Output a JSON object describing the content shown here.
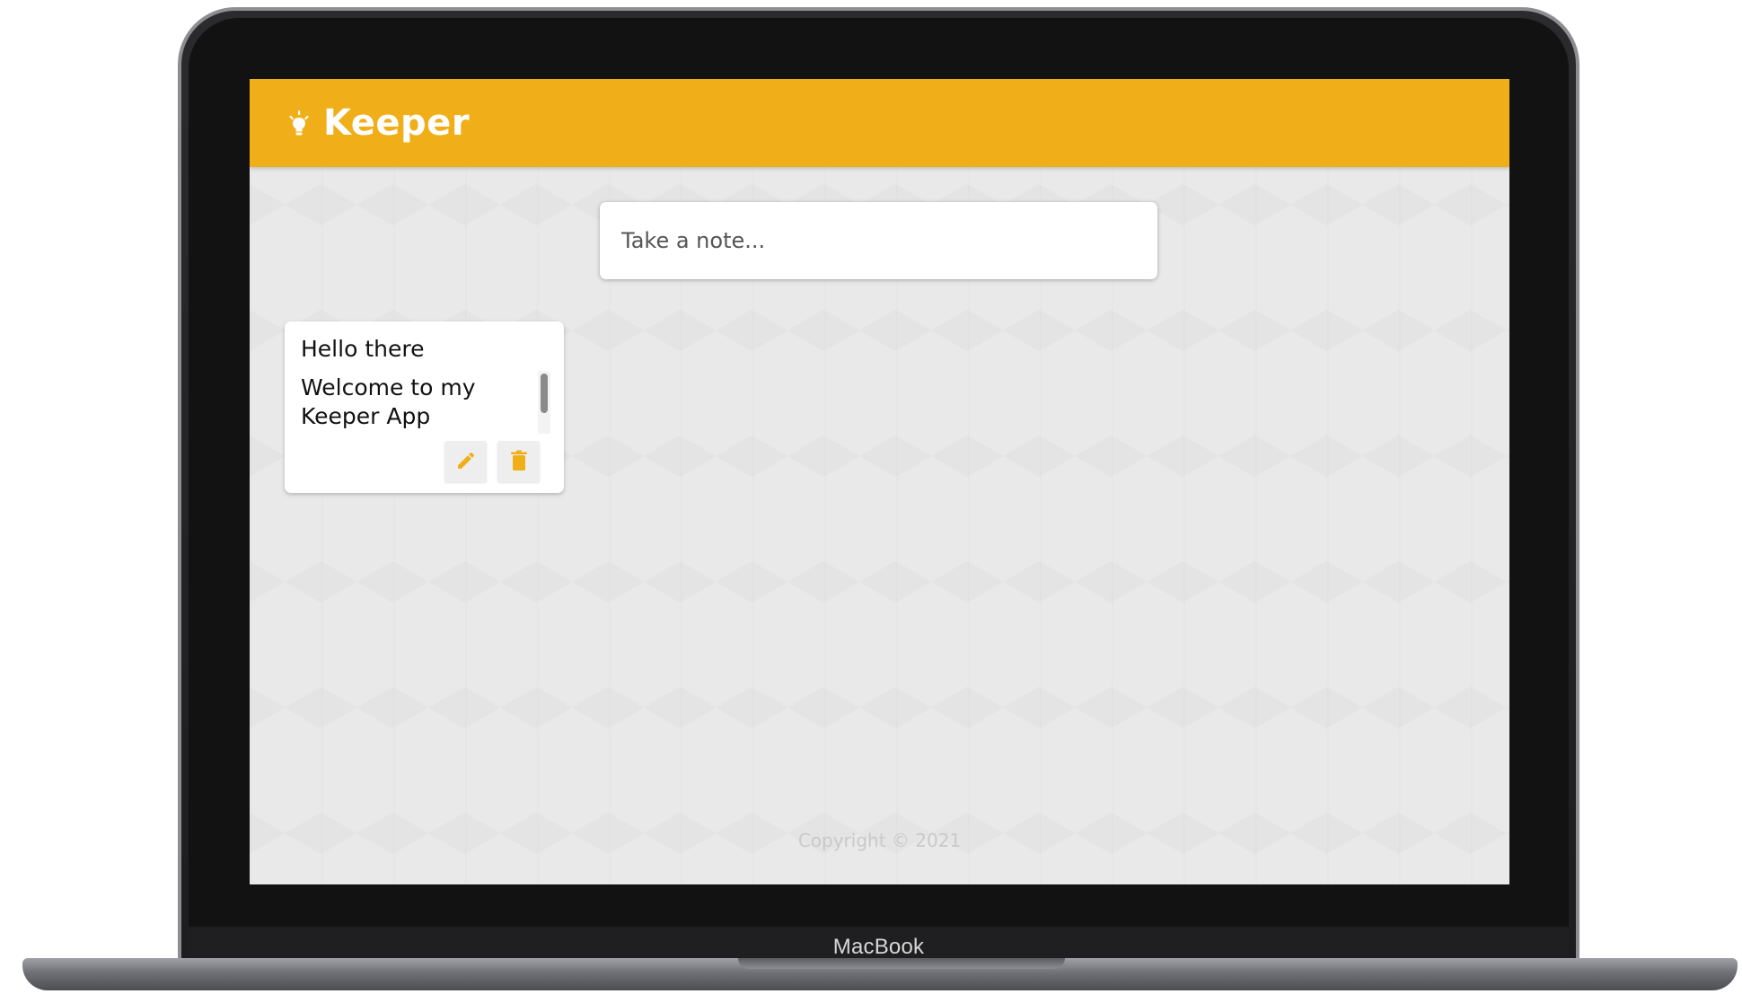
{
  "device": {
    "brand_label": "MacBook"
  },
  "app": {
    "title": "Keeper",
    "logo_icon": "lightbulb-icon",
    "accent_color": "#f0ae18"
  },
  "note_input": {
    "placeholder": "Take a note...",
    "value": ""
  },
  "notes": [
    {
      "title": "Hello there",
      "content": "Welcome to my Keeper App",
      "actions": {
        "edit_icon": "pencil-icon",
        "delete_icon": "trash-icon"
      }
    }
  ],
  "footer": {
    "copyright": "Copyright © 2021"
  }
}
